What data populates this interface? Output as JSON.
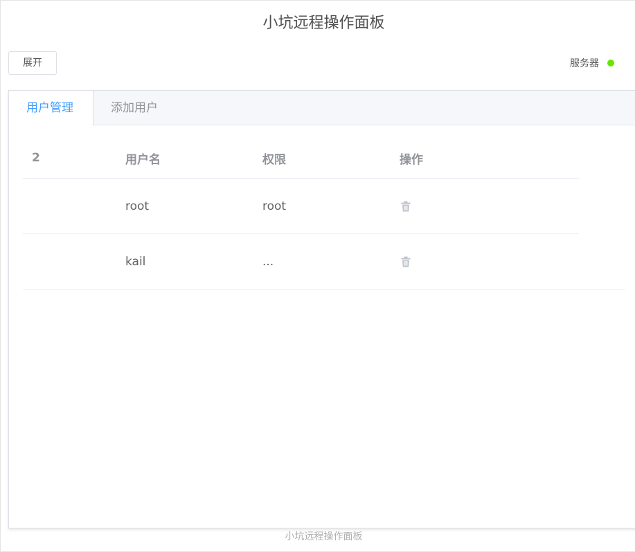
{
  "header": {
    "title": "小坑远程操作面板",
    "expand_label": "展开",
    "server_label": "服务器",
    "server_status_color": "#67e500"
  },
  "tabs": [
    {
      "label": "用户管理",
      "active": true
    },
    {
      "label": "添加用户",
      "active": false
    }
  ],
  "table": {
    "columns": [
      "2",
      "用户名",
      "权限",
      "操作"
    ],
    "rows": [
      {
        "index": "",
        "username": "root",
        "permission": "root",
        "action_icon": "trash-icon"
      },
      {
        "index": "",
        "username": "kail",
        "permission": "...",
        "action_icon": "trash-icon"
      }
    ]
  },
  "footer": {
    "text": "小坑远程操作面板"
  },
  "colors": {
    "accent": "#409eff",
    "icon_gray": "#c0c4cc"
  }
}
